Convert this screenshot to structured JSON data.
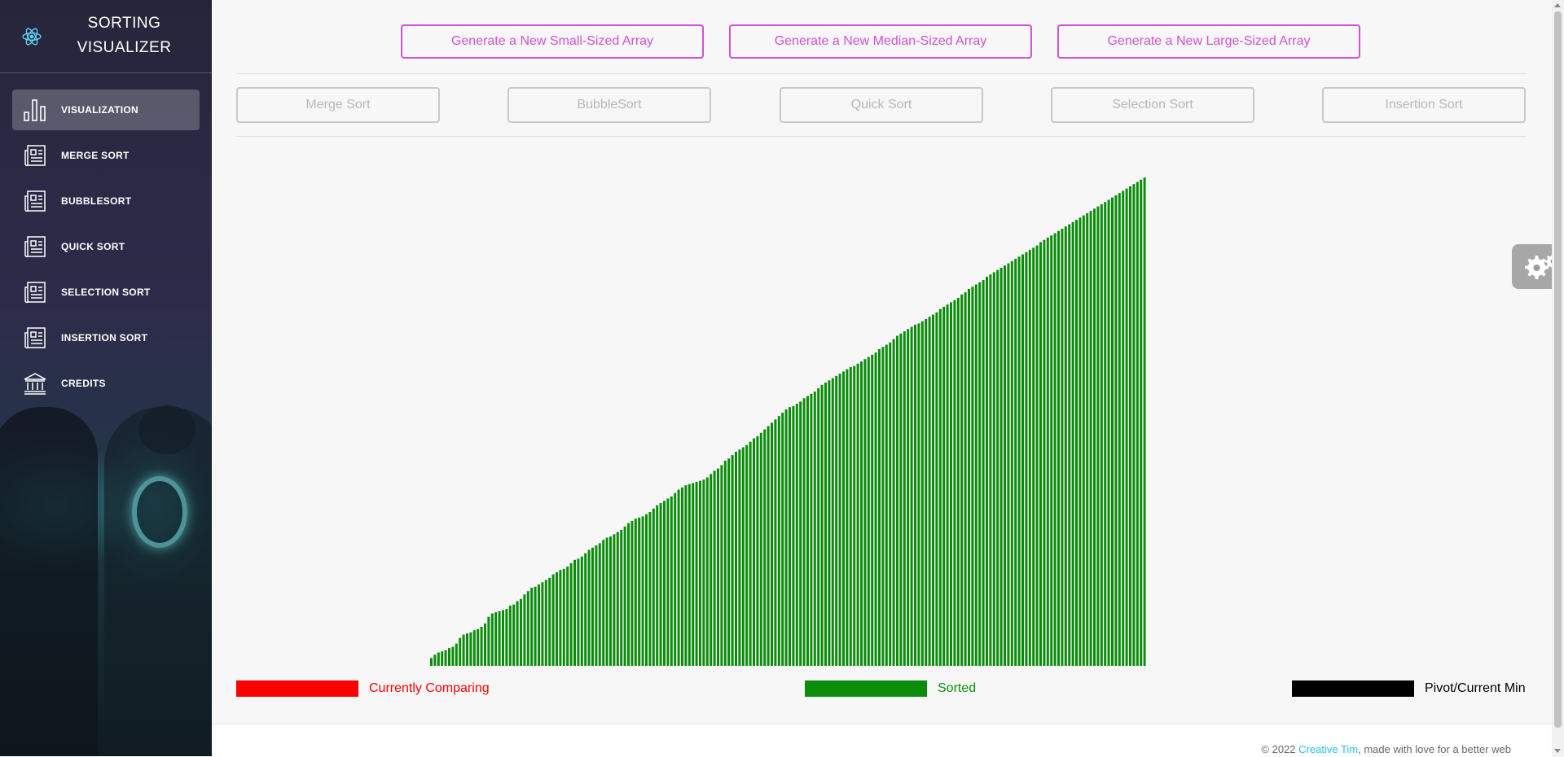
{
  "sidebar": {
    "brand_line1": "SORTING",
    "brand_line2": "VISUALIZER",
    "items": [
      {
        "label": "VISUALIZATION",
        "icon": "bar-chart-icon",
        "active": true
      },
      {
        "label": "MERGE SORT",
        "icon": "news-icon",
        "active": false
      },
      {
        "label": "BUBBLESORT",
        "icon": "news-icon",
        "active": false
      },
      {
        "label": "QUICK SORT",
        "icon": "news-icon",
        "active": false
      },
      {
        "label": "SELECTION SORT",
        "icon": "news-icon",
        "active": false
      },
      {
        "label": "INSERTION SORT",
        "icon": "news-icon",
        "active": false
      },
      {
        "label": "CREDITS",
        "icon": "bank-icon",
        "active": false
      }
    ]
  },
  "generate_buttons": {
    "small": "Generate a New Small-Sized Array",
    "median": "Generate a New Median-Sized Array",
    "large": "Generate a New Large-Sized Array"
  },
  "algorithm_buttons": {
    "merge": "Merge Sort",
    "bubble": "BubbleSort",
    "quick": "Quick Sort",
    "selection": "Selection Sort",
    "insertion": "Insertion Sort"
  },
  "legend": {
    "comparing": {
      "label": "Currently Comparing",
      "color": "#ff0000"
    },
    "sorted": {
      "label": "Sorted",
      "color": "#0b8d0b"
    },
    "pivot": {
      "label": "Pivot/Current Min",
      "color": "#000000"
    }
  },
  "footer": {
    "prefix": "© 2022 ",
    "link": "Creative Tim",
    "suffix": ", made with love for a better web"
  },
  "colors": {
    "accent_pink": "#d052d4",
    "bar_sorted": "#0b8d0b",
    "link_blue": "#1dc7ea"
  },
  "chart_data": {
    "type": "bar",
    "bar_count": 200,
    "bar_color": "#0b8d0b",
    "values": [
      7,
      10,
      12,
      13,
      14,
      16,
      17,
      20,
      25,
      28,
      29,
      30,
      32,
      33,
      35,
      38,
      44,
      47,
      48,
      49,
      50,
      51,
      54,
      55,
      58,
      60,
      64,
      67,
      70,
      71,
      73,
      75,
      77,
      79,
      82,
      84,
      86,
      87,
      89,
      92,
      95,
      96,
      98,
      101,
      104,
      106,
      108,
      110,
      113,
      115,
      116,
      118,
      120,
      122,
      125,
      128,
      130,
      132,
      133,
      134,
      136,
      138,
      141,
      144,
      146,
      148,
      150,
      152,
      155,
      158,
      160,
      162,
      163,
      164,
      165,
      166,
      167,
      169,
      172,
      175,
      177,
      180,
      184,
      186,
      189,
      192,
      194,
      196,
      198,
      201,
      204,
      206,
      209,
      212,
      215,
      218,
      221,
      224,
      227,
      230,
      232,
      233,
      235,
      237,
      240,
      242,
      244,
      246,
      249,
      252,
      254,
      256,
      258,
      260,
      262,
      264,
      266,
      268,
      269,
      271,
      273,
      275,
      277,
      279,
      281,
      284,
      286,
      288,
      290,
      293,
      296,
      298,
      300,
      302,
      304,
      306,
      307,
      309,
      311,
      313,
      315,
      317,
      320,
      322,
      324,
      326,
      328,
      330,
      333,
      335,
      338,
      340,
      342,
      344,
      346,
      349,
      351,
      353,
      355,
      357,
      359,
      361,
      363,
      365,
      367,
      369,
      371,
      373,
      375,
      377,
      380,
      382,
      384,
      386,
      388,
      390,
      392,
      394,
      396,
      398,
      400,
      402,
      404,
      406,
      408,
      410,
      412,
      414,
      416,
      418,
      420,
      422,
      424,
      426,
      428,
      430,
      432,
      434,
      436,
      438,
      440,
      442,
      444,
      446,
      448,
      450,
      452,
      454,
      456,
      458,
      460,
      462,
      464,
      466,
      468,
      470,
      472,
      474,
      476,
      478,
      480,
      482,
      484,
      486,
      488,
      490,
      492,
      494,
      496,
      498,
      500,
      502,
      504,
      506,
      508,
      510,
      512,
      514,
      516,
      518,
      520,
      522,
      524,
      526,
      528,
      530,
      532,
      534,
      536,
      538,
      540,
      542,
      544,
      546,
      548,
      550,
      552,
      554,
      556,
      558,
      560,
      562,
      564,
      566,
      568,
      570,
      572,
      574,
      576,
      578,
      580,
      582,
      584,
      586,
      588,
      590,
      592,
      594,
      596,
      598,
      600
    ]
  }
}
